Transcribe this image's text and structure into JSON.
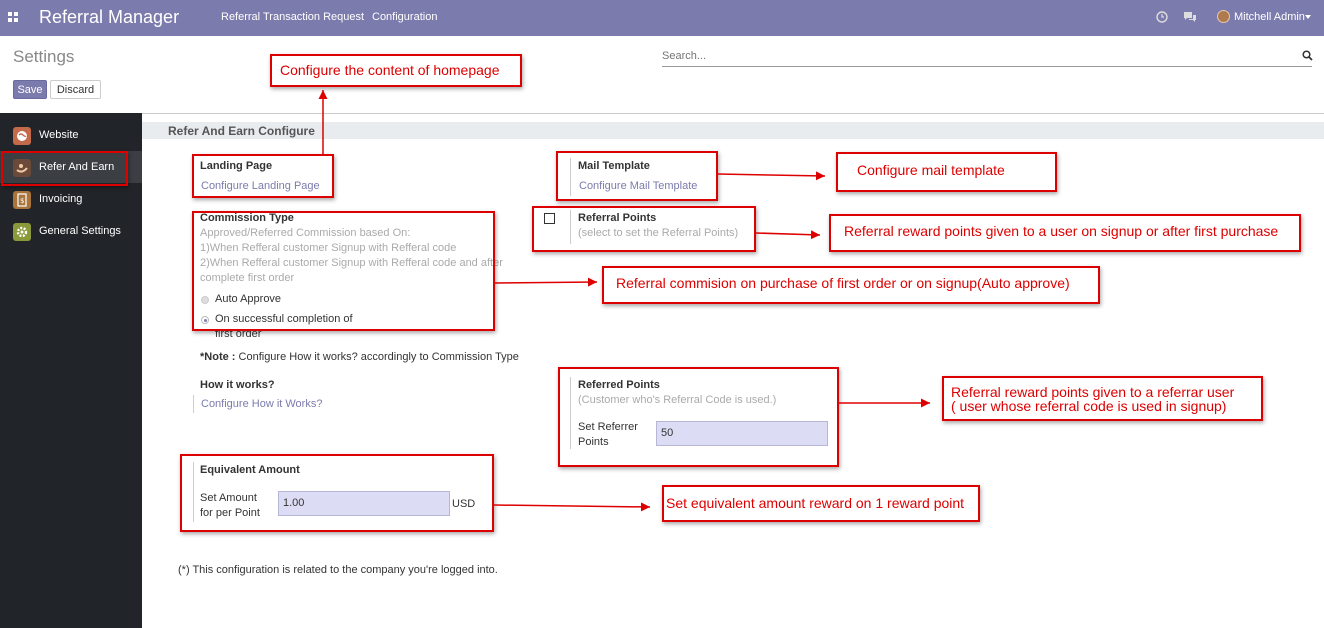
{
  "navbar": {
    "app_title": "Referral Manager",
    "menu": [
      "Referral Transaction Request",
      "Configuration"
    ],
    "user_name": "Mitchell Admin",
    "bg_color": "#7c7bad"
  },
  "control_panel": {
    "title": "Settings",
    "search_placeholder": "Search...",
    "save_label": "Save",
    "discard_label": "Discard"
  },
  "sidebar": {
    "items": [
      {
        "label": "Website",
        "icon": "globe-icon"
      },
      {
        "label": "Refer And Earn",
        "icon": "refer-and-earn-icon"
      },
      {
        "label": "Invoicing",
        "icon": "invoice-icon"
      },
      {
        "label": "General Settings",
        "icon": "gear-icon"
      }
    ],
    "active_index": 1
  },
  "section": {
    "title": "Refer And Earn Configure"
  },
  "landing_page": {
    "label": "Landing Page",
    "link": "Configure Landing Page"
  },
  "mail_template": {
    "label": "Mail Template",
    "link": "Configure Mail Template"
  },
  "commission": {
    "label": "Commission Type",
    "desc1": "Approved/Referred Commission based On:",
    "desc2": "1)When Refferal customer Signup with Refferal code",
    "desc3": "2)When Refferal customer Signup with Refferal code and after",
    "desc4": "complete first order",
    "option1": "Auto Approve",
    "option2_line1": "On successful completion of",
    "option2_line2": "first order",
    "selected": "On successful completion of first order"
  },
  "note": {
    "prefix": "*Note :",
    "text": " Configure How it works? accordingly to Commission Type"
  },
  "referral_points": {
    "label": "Referral Points",
    "desc": "(select to set the Referral Points)",
    "checked": false
  },
  "how_it_works": {
    "label": "How it works?",
    "link": "Configure How it Works?"
  },
  "referred_points": {
    "label": "Referred Points",
    "desc": "(Customer who's Referral Code is used.)",
    "field_label_1": "Set Referrer",
    "field_label_2": "Points",
    "value": "50"
  },
  "equivalent_amount": {
    "label": "Equivalent Amount",
    "field_label_1": "Set Amount",
    "field_label_2": "for per Point",
    "value": "1.00",
    "currency": "USD"
  },
  "footer_note": "(*) This configuration is related to the company you're logged into.",
  "callouts": {
    "homepage": "Configure the content of homepage",
    "mail": "Configure mail template",
    "referral_points": "Referral reward points given to a user  on signup or after first purchase",
    "commission": "Referral commision on purchase of first order or on signup(Auto approve)",
    "referred_1": "Referral reward points given to a referrar user",
    "referred_2": "( user whose referral code is used in signup)",
    "equivalent": "Set equivalent amount  reward on 1 reward point"
  },
  "annotation_color": "#dd0000"
}
